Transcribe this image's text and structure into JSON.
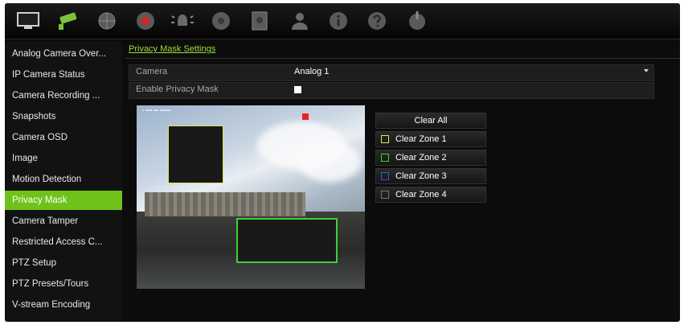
{
  "toolbar": {
    "icons": [
      {
        "name": "monitor-icon",
        "color": "#cfcfcf"
      },
      {
        "name": "camera-icon",
        "color": "#7cc23a"
      },
      {
        "name": "network-icon",
        "color": "#9a9a9a"
      },
      {
        "name": "record-icon",
        "color": "#d22"
      },
      {
        "name": "alarm-icon",
        "color": "#9a9a9a"
      },
      {
        "name": "hdd-icon",
        "color": "#9a9a9a"
      },
      {
        "name": "device-icon",
        "color": "#9a9a9a"
      },
      {
        "name": "user-icon",
        "color": "#9a9a9a"
      },
      {
        "name": "info-icon",
        "color": "#9a9a9a"
      },
      {
        "name": "help-icon",
        "color": "#9a9a9a"
      },
      {
        "name": "power-icon",
        "color": "#9a9a9a"
      }
    ]
  },
  "sidebar": {
    "items": [
      {
        "label": "Analog Camera Over..."
      },
      {
        "label": "IP Camera Status"
      },
      {
        "label": "Camera Recording ..."
      },
      {
        "label": "Snapshots"
      },
      {
        "label": "Camera OSD"
      },
      {
        "label": "Image"
      },
      {
        "label": "Motion Detection"
      },
      {
        "label": "Privacy Mask"
      },
      {
        "label": "Camera Tamper"
      },
      {
        "label": "Restricted Access C..."
      },
      {
        "label": "PTZ Setup"
      },
      {
        "label": "PTZ Presets/Tours"
      },
      {
        "label": "V-stream Encoding"
      }
    ],
    "active_index": 7
  },
  "main": {
    "breadcrumb": "Privacy Mask Settings",
    "camera_label": "Camera",
    "camera_value": "Analog 1",
    "enable_label": "Enable Privacy Mask",
    "enable_checked": true
  },
  "buttons": {
    "clear_all": "Clear All",
    "zones": [
      {
        "label": "Clear Zone 1",
        "color": "#e3e35a"
      },
      {
        "label": "Clear Zone 2",
        "color": "#3ad33a"
      },
      {
        "label": "Clear Zone 3",
        "color": "#2d5bd8"
      },
      {
        "label": "Clear Zone 4",
        "color": "#777777"
      }
    ]
  },
  "accent_color": "#6fc21a"
}
